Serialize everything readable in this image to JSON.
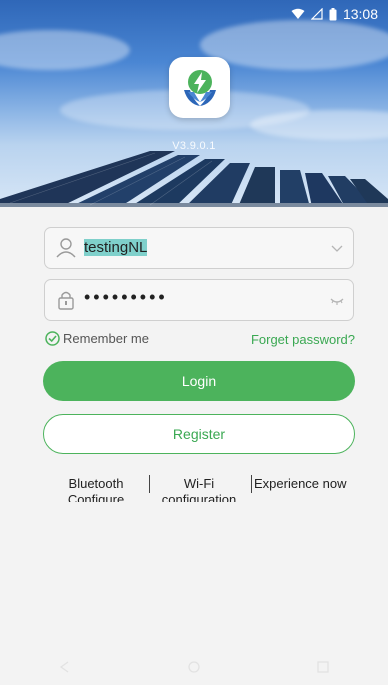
{
  "status_bar": {
    "time": "13:08",
    "icons": [
      "wifi-icon",
      "sim-icon",
      "battery-icon"
    ]
  },
  "app": {
    "version": "V3.9.0.1",
    "logo_icon": "leaf-lightning-logo-icon"
  },
  "login_form": {
    "username_value": "testingNL",
    "password_value": "•••••••••",
    "remember_label": "Remember me",
    "remember_checked": true,
    "forget_label": "Forget password?",
    "login_label": "Login",
    "register_label": "Register"
  },
  "quick_links": {
    "bluetooth_label": "Bluetooth Configure",
    "wifi_label": "Wi-Fi configuration",
    "experience_label": "Experience now"
  },
  "colors": {
    "accent": "#4cb35c",
    "accent_text": "#3aa852"
  },
  "navbar": {
    "icons": [
      "back-icon",
      "home-icon",
      "recents-icon"
    ]
  }
}
